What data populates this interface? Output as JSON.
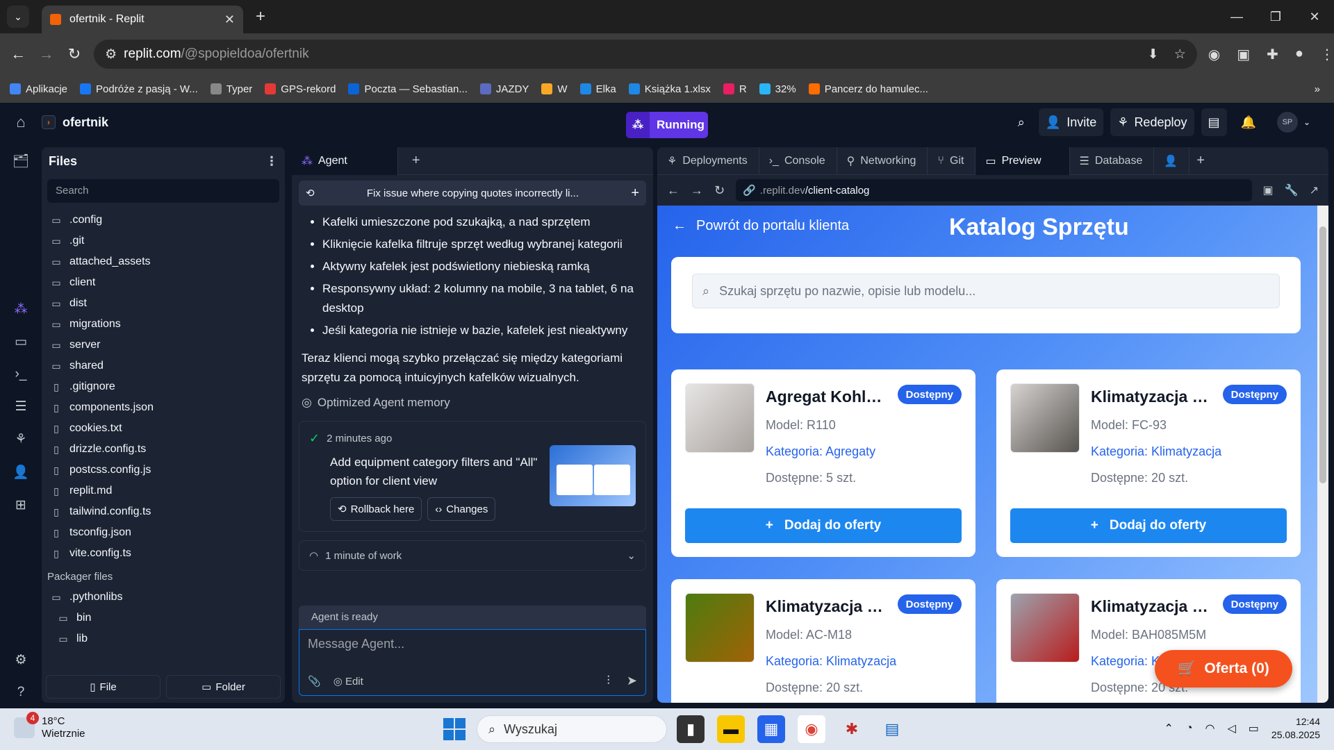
{
  "browser": {
    "tab_title": "ofertnik - Replit",
    "url_host": "replit.com",
    "url_path": "/@spopieldoa/ofertnik",
    "bookmarks": [
      "Aplikacje",
      "Podróże z pasją - W...",
      "Typer",
      "GPS-rekord",
      "Poczta — Sebastian...",
      "JAZDY",
      "W",
      "Elka",
      "Książka 1.xlsx",
      "R",
      "32%",
      "Pancerz do hamulec..."
    ]
  },
  "replit": {
    "repl_name": "ofertnik",
    "run_label": "Running",
    "invite_label": "Invite",
    "redeploy_label": "Redeploy",
    "avatar_initials": "SP"
  },
  "files": {
    "title": "Files",
    "search_placeholder": "Search",
    "items": [
      ".config",
      ".git",
      "attached_assets",
      "client",
      "dist",
      "migrations",
      "server",
      "shared",
      ".gitignore",
      "components.json",
      "cookies.txt",
      "drizzle.config.ts",
      "postcss.config.js",
      "replit.md",
      "tailwind.config.ts",
      "tsconfig.json",
      "vite.config.ts"
    ],
    "packager_title": "Packager files",
    "packager_items": [
      ".pythonlibs",
      "bin",
      "lib"
    ],
    "new_file": "File",
    "new_folder": "Folder"
  },
  "agent": {
    "tab_label": "Agent",
    "thread_title": "Fix issue where copying quotes incorrectly li...",
    "bullets": [
      "Kafelki umieszczone pod szukajką, a nad sprzętem",
      "Kliknięcie kafelka filtruje sprzęt według wybranej kategorii",
      "Aktywny kafelek jest podświetlony niebieską ramką",
      "Responsywny układ: 2 kolumny na mobile, 3 na tablet, 6 na desktop",
      "Jeśli kategoria nie istnieje w bazie, kafelek jest nieaktywny"
    ],
    "paragraph": "Teraz klienci mogą szybko przełączać się między kategoriami sprzętu za pomocą intuicyjnych kafelków wizualnych.",
    "memory_note": "Optimized Agent memory",
    "checkpoint": {
      "time": "2 minutes ago",
      "title": "Add equipment category filters and \"All\" option for client view",
      "rollback": "Rollback here",
      "changes": "Changes"
    },
    "work_label": "1 minute of work",
    "status": "Agent is ready",
    "input_placeholder": "Message Agent...",
    "edit_label": "Edit"
  },
  "workspace_tabs": [
    "Deployments",
    "Console",
    "Networking",
    "Git",
    "Preview",
    "Database"
  ],
  "preview": {
    "url_host": ".replit.dev",
    "url_path": "/client-catalog",
    "back_link": "Powrót do portalu klienta",
    "title": "Katalog Sprzętu",
    "search_placeholder": "Szukaj sprzętu po nazwie, opisie lub modelu...",
    "cards": [
      {
        "name": "Agregat Kohler ...",
        "badge": "Dostępny",
        "model": "Model: R110",
        "category": "Kategoria: Agregaty",
        "stock": "Dostępne: 5 szt.",
        "button": "Dodaj do oferty"
      },
      {
        "name": "Klimatyzacja Car...",
        "badge": "Dostępny",
        "model": "Model: FC-93",
        "category": "Kategoria: Klimatyzacja",
        "stock": "Dostępne: 20 szt.",
        "button": "Dodaj do oferty"
      },
      {
        "name": "Klimatyzacja Da...",
        "badge": "Dostępny",
        "model": "Model: AC-M18",
        "category": "Kategoria: Klimatyzacja",
        "stock": "Dostępne: 20 szt.",
        "button": "Dodaj do oferty"
      },
      {
        "name": "Klimatyzacja Len...",
        "badge": "Dostępny",
        "model": "Model: BAH085M5M",
        "category": "Kategoria: K",
        "stock": "Dostępne: 20 szt.",
        "button": "Dodaj do oferty"
      }
    ],
    "offer_button": "Oferta (0)"
  },
  "taskbar": {
    "temp": "18°C",
    "weather": "Wietrznie",
    "notif_count": "4",
    "search_label": "Wyszukaj",
    "time": "12:44",
    "date": "25.08.2025"
  }
}
